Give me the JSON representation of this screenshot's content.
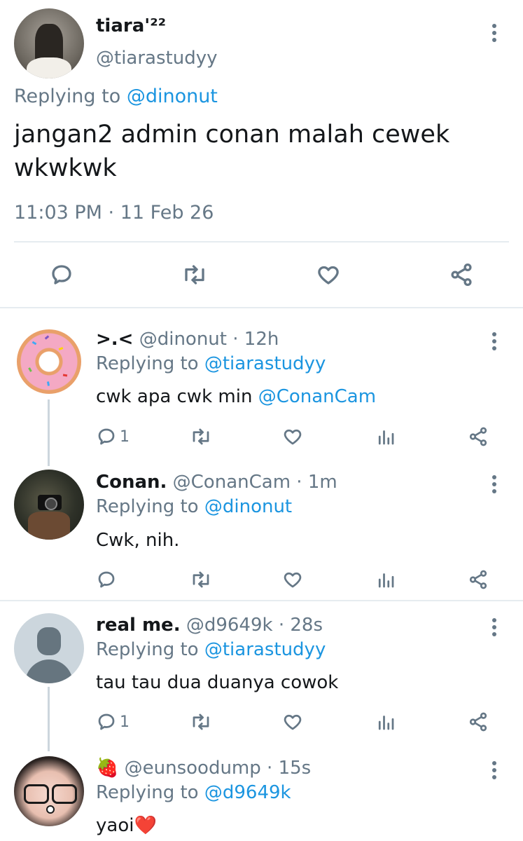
{
  "main_tweet": {
    "display_name": "tiara'²²",
    "handle": "@tiarastudyy",
    "replying_label": "Replying to",
    "replying_handle": "@dinonut",
    "text_line1": "jangan2 admin conan malah cewek",
    "text_line2": "wkwkwk",
    "timestamp": "11:03 PM · 11 Feb 26"
  },
  "replies": [
    {
      "display_name": ">.<",
      "handle": "@dinonut",
      "time": "· 12h",
      "replying_label": "Replying to",
      "replying_handle": "@tiarastudyy",
      "text": "cwk apa cwk min",
      "mention": "@ConanCam",
      "reply_count": "1"
    },
    {
      "display_name": "Conan.",
      "handle": "@ConanCam",
      "time": "· 1m",
      "replying_label": "Replying to",
      "replying_handle": "@dinonut",
      "text": "Cwk, nih.",
      "reply_count": ""
    },
    {
      "display_name": "real me.",
      "handle": "@d9649k",
      "time": "· 28s",
      "replying_label": "Replying to",
      "replying_handle": "@tiarastudyy",
      "text": "tau tau dua duanya cowok",
      "reply_count": "1"
    },
    {
      "display_name": "🍓",
      "handle": "@eunsoodump",
      "time": "· 15s",
      "replying_label": "Replying to",
      "replying_handle": "@d9649k",
      "text": "yaoi",
      "emoji": "❤️"
    }
  ],
  "colors": {
    "accent": "#1b95e0",
    "muted": "#657786",
    "divider": "#e6ecf0"
  },
  "icons": [
    "reply-icon",
    "retweet-icon",
    "like-icon",
    "share-icon",
    "analytics-icon",
    "more-icon",
    "default-avatar-icon"
  ]
}
